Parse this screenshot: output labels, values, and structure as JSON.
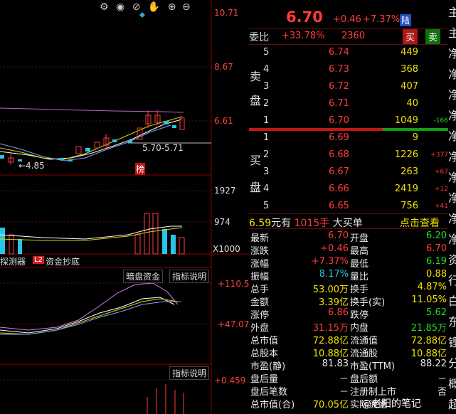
{
  "chart": {
    "toolbar_icons": [
      "settings-icon",
      "eye-icon",
      "eye-off-icon",
      "hand-icon",
      "zoom-in-icon",
      "zoom-out-icon"
    ],
    "price_axis": [
      "10.71",
      "8.67",
      "6.61"
    ],
    "annot_range": "5.70-5.71",
    "annot_low": "←4.85",
    "annot_bang": "榜",
    "vol_axis": [
      "1927",
      "974",
      "X1000"
    ],
    "tabs": [
      "探测器",
      "L2",
      "资金抄底"
    ],
    "hidden_fund_btn": "暗盘资金",
    "indicator_btn": "指标说明",
    "ind_axis": [
      "+110.5",
      "+47.07"
    ],
    "indicator_btn2": "指标说明",
    "ind2_axis": "+0.459"
  },
  "quote": {
    "price": "6.70",
    "change": "+0.46",
    "change_pct": "+7.37%",
    "market_tag": "陆",
    "weibi_label": "委比",
    "weibi_val": "+33.78%",
    "weicha_val": "2360",
    "buy_btn": "买",
    "sell_btn": "卖"
  },
  "sell_label": [
    "卖",
    "盘"
  ],
  "buy_label": [
    "买",
    "盘"
  ],
  "asks": [
    {
      "lvl": "5",
      "price": "6.74",
      "vol": "449",
      "chg": ""
    },
    {
      "lvl": "4",
      "price": "6.73",
      "vol": "368",
      "chg": ""
    },
    {
      "lvl": "3",
      "price": "6.72",
      "vol": "407",
      "chg": ""
    },
    {
      "lvl": "2",
      "price": "6.71",
      "vol": "40",
      "chg": ""
    },
    {
      "lvl": "1",
      "price": "6.70",
      "vol": "1049",
      "chg": "-166"
    }
  ],
  "bids": [
    {
      "lvl": "1",
      "price": "6.69",
      "vol": "9",
      "chg": ""
    },
    {
      "lvl": "2",
      "price": "6.68",
      "vol": "1226",
      "chg": "+377"
    },
    {
      "lvl": "3",
      "price": "6.67",
      "vol": "263",
      "chg": "+67"
    },
    {
      "lvl": "4",
      "price": "6.66",
      "vol": "2419",
      "chg": "+12"
    },
    {
      "lvl": "5",
      "price": "6.65",
      "vol": "756",
      "chg": "+41"
    }
  ],
  "bigorder": {
    "price": "6.59",
    "unit": "元有",
    "qty": "1015手",
    "label": "大买单",
    "link": "点击查看"
  },
  "stats": [
    {
      "l": "最新",
      "lv": "6.70",
      "r": "开盘",
      "rv": "6.20",
      "lc": "red",
      "rc": "grn"
    },
    {
      "l": "涨跌",
      "lv": "+0.46",
      "r": "最高",
      "rv": "6.70",
      "lc": "red",
      "rc": "red"
    },
    {
      "l": "涨幅",
      "lv": "+7.37%",
      "r": "最低",
      "rv": "6.19",
      "lc": "red",
      "rc": "grn"
    },
    {
      "l": "振幅",
      "lv": "8.17%",
      "r": "量比",
      "rv": "0.88",
      "lc": "cyan",
      "rc": "yel"
    },
    {
      "l": "总手",
      "lv": "53.00万",
      "r": "换手",
      "rv": "4.87%",
      "lc": "yel",
      "rc": "yel"
    },
    {
      "l": "金额",
      "lv": "3.39亿",
      "r": "换手(实)",
      "rv": "11.05%",
      "lc": "yel",
      "rc": "yel"
    },
    {
      "l": "涨停",
      "lv": "6.86",
      "r": "跌停",
      "rv": "5.62",
      "lc": "red",
      "rc": "grn"
    },
    {
      "l": "外盘",
      "lv": "31.15万",
      "r": "内盘",
      "rv": "21.85万",
      "lc": "red",
      "rc": "grn"
    },
    {
      "l": "总市值",
      "lv": "72.88亿",
      "r": "流通值",
      "rv": "72.88亿",
      "lc": "yel",
      "rc": "yel"
    },
    {
      "l": "总股本",
      "lv": "10.88亿",
      "r": "流通股",
      "rv": "10.88亿",
      "lc": "yel",
      "rc": "yel"
    },
    {
      "l": "市盈(静)",
      "lv": "81.83",
      "r": "市盈(TTM)",
      "rv": "88.22",
      "lc": "wht",
      "rc": "wht"
    },
    {
      "l": "盘后量",
      "lv": "－",
      "r": "盘后额",
      "rv": "－",
      "lc": "wht",
      "rc": "wht"
    },
    {
      "l": "盘后笔数",
      "lv": "－",
      "r": "注册制上市",
      "rv": "否",
      "lc": "wht",
      "rc": "wht"
    },
    {
      "l": "总市值(合)",
      "lv": "70.05亿",
      "r": "实际流通",
      "rv": "",
      "lc": "yel",
      "rc": "yel"
    }
  ],
  "watermark": "@老阳的笔记",
  "side_chars": [
    "主",
    "主",
    "净",
    "净",
    "净",
    "净",
    "净",
    "净",
    "净",
    "净",
    "净",
    "净",
    "资",
    "行",
    "白",
    "东",
    "锂",
    "分",
    "概",
    "超"
  ]
}
